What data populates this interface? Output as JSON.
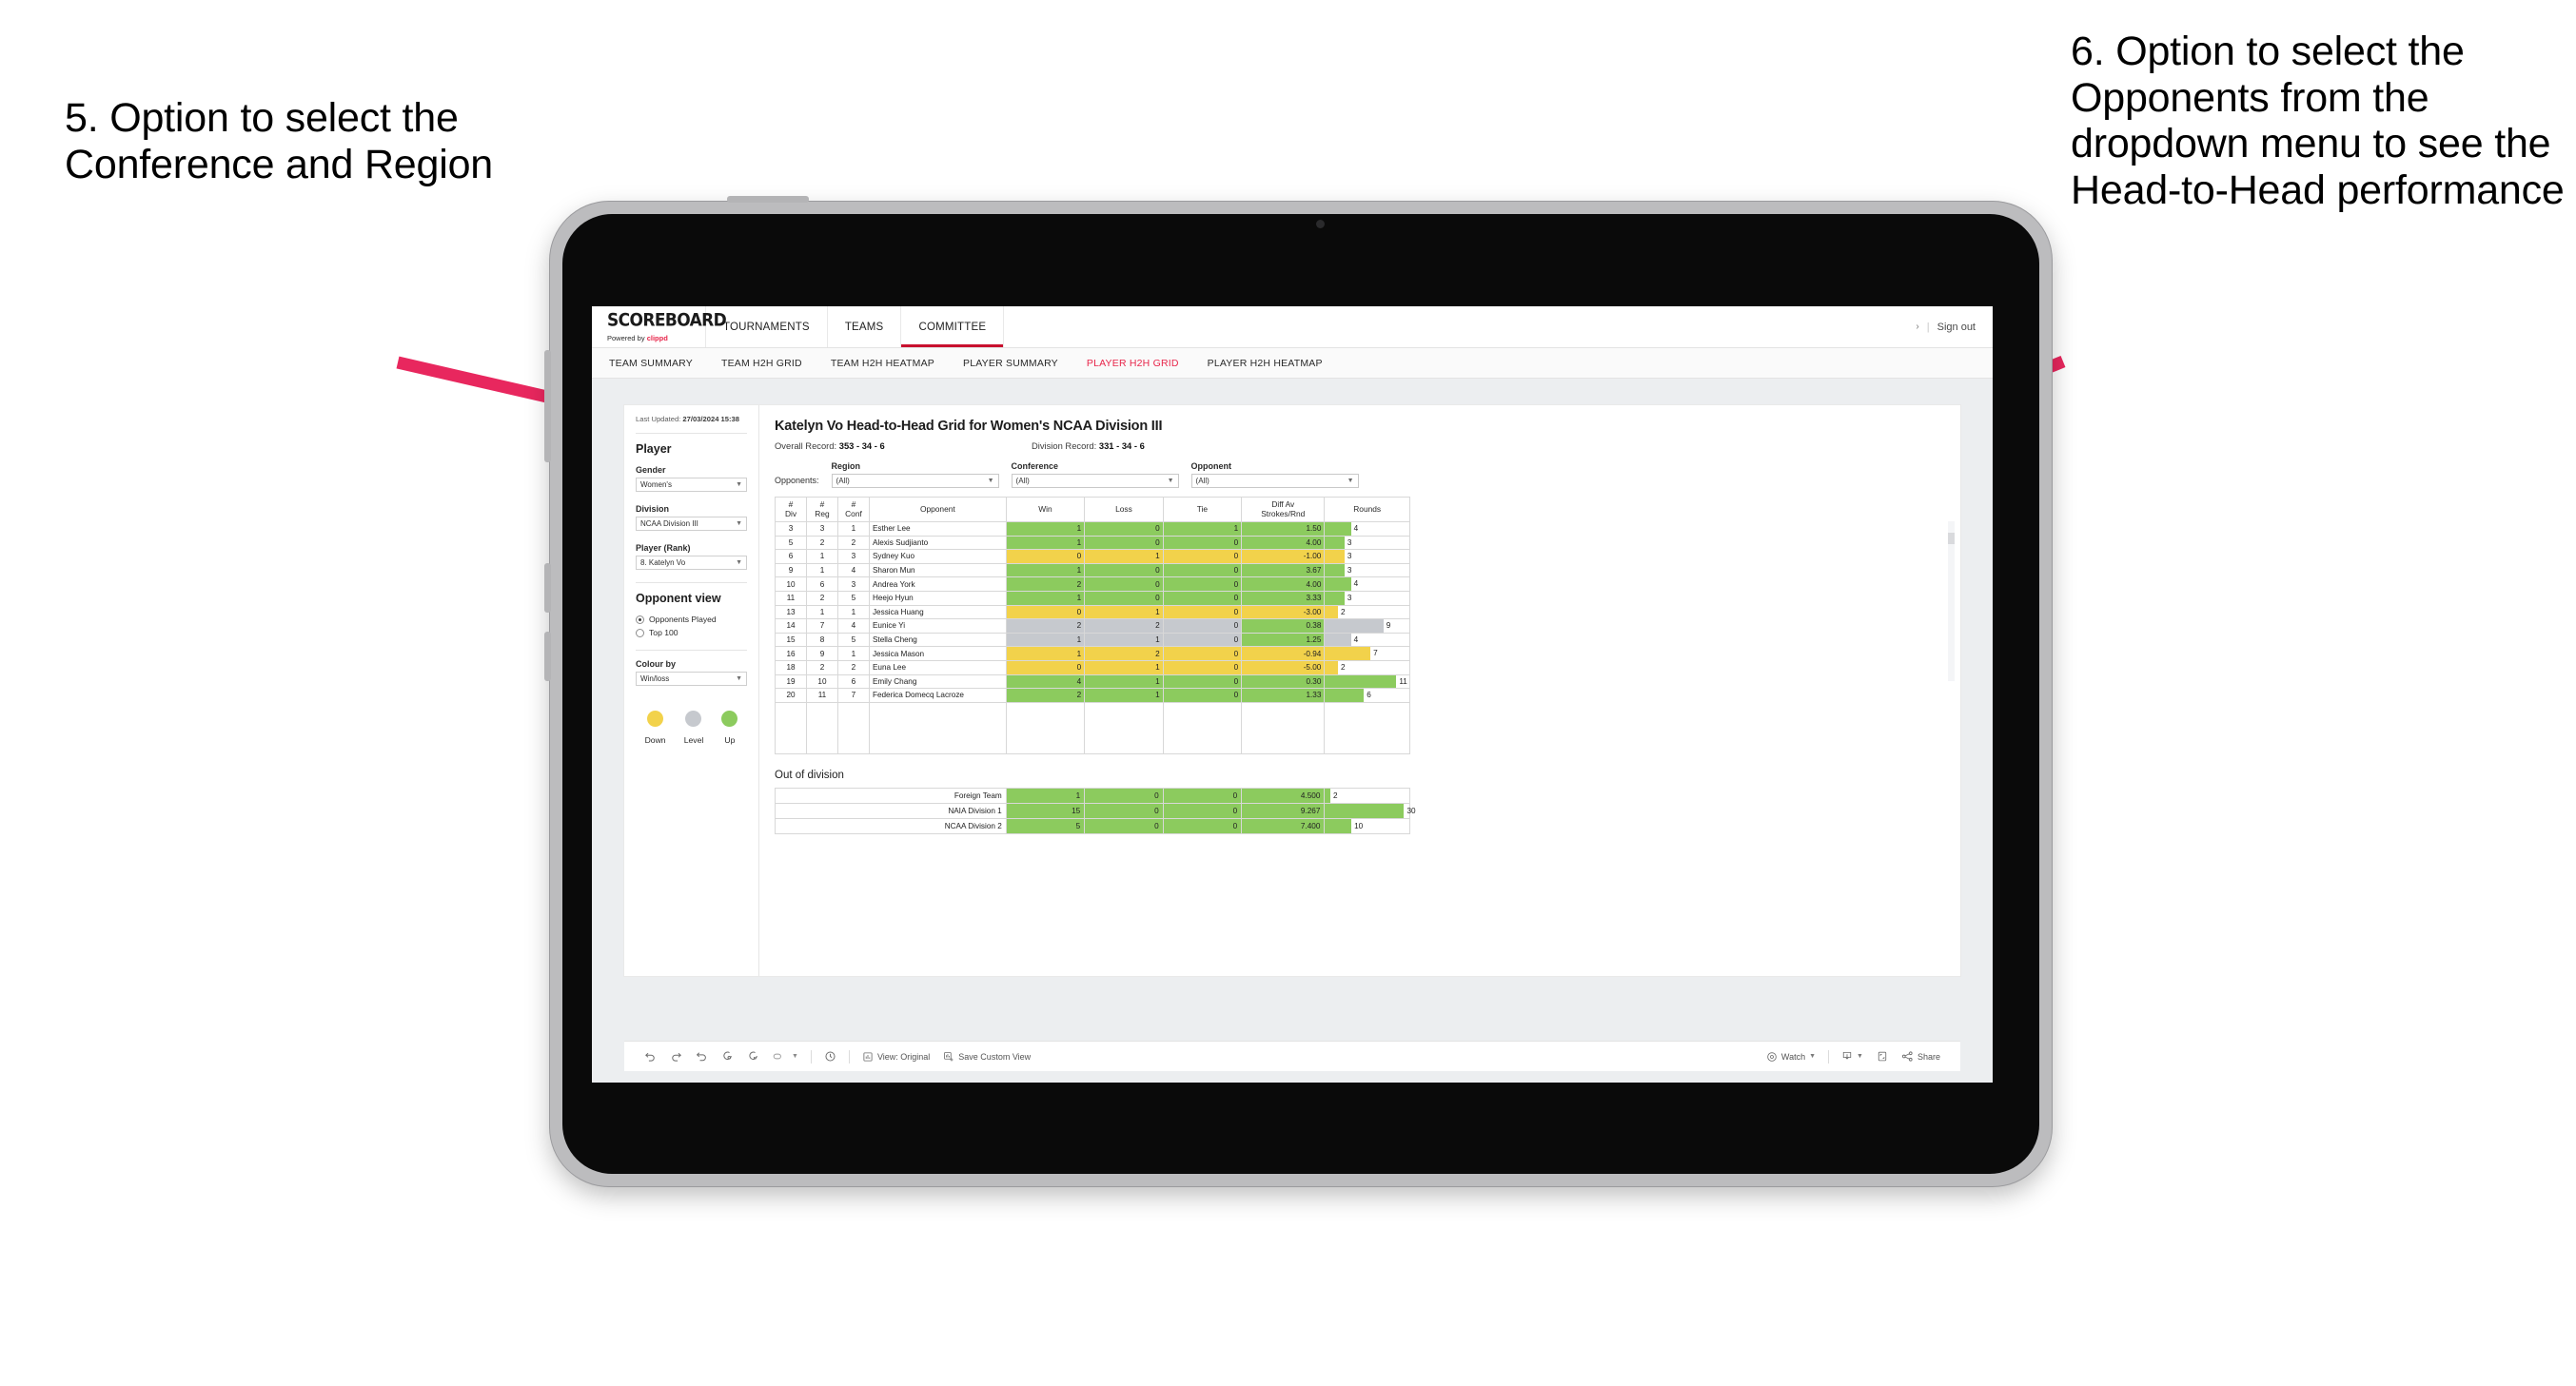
{
  "annotations": {
    "left": "5. Option to select the Conference and Region",
    "right": "6. Option to select the Opponents from the dropdown menu to see the Head-to-Head performance",
    "arrow_color": "#e8275e"
  },
  "app": {
    "logo": {
      "word": "SCOREBOARD",
      "powered_prefix": "Powered by ",
      "powered_brand": "clippd"
    },
    "topnav": [
      {
        "label": "TOURNAMENTS",
        "active": false
      },
      {
        "label": "TEAMS",
        "active": false
      },
      {
        "label": "COMMITTEE",
        "active": true
      }
    ],
    "account": {
      "chevron": "›",
      "separator": "|",
      "sign_out": "Sign out"
    },
    "subnav": [
      {
        "label": "TEAM SUMMARY",
        "active": false
      },
      {
        "label": "TEAM H2H GRID",
        "active": false
      },
      {
        "label": "TEAM H2H HEATMAP",
        "active": false
      },
      {
        "label": "PLAYER SUMMARY",
        "active": false
      },
      {
        "label": "PLAYER H2H GRID",
        "active": true
      },
      {
        "label": "PLAYER H2H HEATMAP",
        "active": false
      }
    ],
    "accent_color": "#e8264b"
  },
  "sidebar": {
    "last_updated_label": "Last Updated: ",
    "last_updated_value": "27/03/2024 15:38",
    "player_heading": "Player",
    "fields": [
      {
        "label": "Gender",
        "value": "Women's"
      },
      {
        "label": "Division",
        "value": "NCAA Division III"
      },
      {
        "label": "Player (Rank)",
        "value": "8. Katelyn Vo"
      }
    ],
    "opponent_view": {
      "heading": "Opponent view",
      "options": [
        {
          "label": "Opponents Played",
          "selected": true
        },
        {
          "label": "Top 100",
          "selected": false
        }
      ]
    },
    "colour_by": {
      "label": "Colour by",
      "value": "Win/loss"
    },
    "legend": [
      {
        "label": "Down",
        "color": "#f2d24b"
      },
      {
        "label": "Level",
        "color": "#c6c9ce"
      },
      {
        "label": "Up",
        "color": "#8ccb5e"
      }
    ]
  },
  "main": {
    "title": "Katelyn Vo Head-to-Head Grid for Women's NCAA Division III",
    "records": [
      {
        "label": "Overall Record: ",
        "value": "353 - 34 - 6"
      },
      {
        "label": "Division Record: ",
        "value": "331 - 34 - 6"
      }
    ],
    "filters_prefix": "Opponents:",
    "filters": [
      {
        "label": "Region",
        "value": "(All)"
      },
      {
        "label": "Conference",
        "value": "(All)"
      },
      {
        "label": "Opponent",
        "value": "(All)"
      }
    ],
    "grid": {
      "columns": [
        "# Div",
        "# Reg",
        "# Conf",
        "Opponent",
        "Win",
        "Loss",
        "Tie",
        "Diff Av Strokes/Rnd",
        "Rounds"
      ],
      "column_lines": [
        [
          "#",
          "Div"
        ],
        [
          "#",
          "Reg"
        ],
        [
          "#",
          "Conf"
        ],
        [
          "Opponent"
        ],
        [
          "Win"
        ],
        [
          "Loss"
        ],
        [
          "Tie"
        ],
        [
          "Diff Av",
          "Strokes/Rnd"
        ],
        [
          "Rounds"
        ]
      ],
      "rounds_max": 13,
      "rows": [
        {
          "div": "3",
          "reg": "3",
          "conf": "1",
          "opponent": "Esther Lee",
          "win": "1",
          "loss": "0",
          "tie": "1",
          "diff": "1.50",
          "rounds": "4",
          "state": "up"
        },
        {
          "div": "5",
          "reg": "2",
          "conf": "2",
          "opponent": "Alexis Sudjianto",
          "win": "1",
          "loss": "0",
          "tie": "0",
          "diff": "4.00",
          "rounds": "3",
          "state": "up"
        },
        {
          "div": "6",
          "reg": "1",
          "conf": "3",
          "opponent": "Sydney Kuo",
          "win": "0",
          "loss": "1",
          "tie": "0",
          "diff": "-1.00",
          "rounds": "3",
          "state": "down"
        },
        {
          "div": "9",
          "reg": "1",
          "conf": "4",
          "opponent": "Sharon Mun",
          "win": "1",
          "loss": "0",
          "tie": "0",
          "diff": "3.67",
          "rounds": "3",
          "state": "up"
        },
        {
          "div": "10",
          "reg": "6",
          "conf": "3",
          "opponent": "Andrea York",
          "win": "2",
          "loss": "0",
          "tie": "0",
          "diff": "4.00",
          "rounds": "4",
          "state": "up"
        },
        {
          "div": "11",
          "reg": "2",
          "conf": "5",
          "opponent": "Heejo Hyun",
          "win": "1",
          "loss": "0",
          "tie": "0",
          "diff": "3.33",
          "rounds": "3",
          "state": "up"
        },
        {
          "div": "13",
          "reg": "1",
          "conf": "1",
          "opponent": "Jessica Huang",
          "win": "0",
          "loss": "1",
          "tie": "0",
          "diff": "-3.00",
          "rounds": "2",
          "state": "down"
        },
        {
          "div": "14",
          "reg": "7",
          "conf": "4",
          "opponent": "Eunice Yi",
          "win": "2",
          "loss": "2",
          "tie": "0",
          "diff": "0.38",
          "rounds": "9",
          "state": "level",
          "diff_state": "up"
        },
        {
          "div": "15",
          "reg": "8",
          "conf": "5",
          "opponent": "Stella Cheng",
          "win": "1",
          "loss": "1",
          "tie": "0",
          "diff": "1.25",
          "rounds": "4",
          "state": "level",
          "diff_state": "up"
        },
        {
          "div": "16",
          "reg": "9",
          "conf": "1",
          "opponent": "Jessica Mason",
          "win": "1",
          "loss": "2",
          "tie": "0",
          "diff": "-0.94",
          "rounds": "7",
          "state": "down"
        },
        {
          "div": "18",
          "reg": "2",
          "conf": "2",
          "opponent": "Euna Lee",
          "win": "0",
          "loss": "1",
          "tie": "0",
          "diff": "-5.00",
          "rounds": "2",
          "state": "down"
        },
        {
          "div": "19",
          "reg": "10",
          "conf": "6",
          "opponent": "Emily Chang",
          "win": "4",
          "loss": "1",
          "tie": "0",
          "diff": "0.30",
          "rounds": "11",
          "state": "up"
        },
        {
          "div": "20",
          "reg": "11",
          "conf": "7",
          "opponent": "Federica Domecq Lacroze",
          "win": "2",
          "loss": "1",
          "tie": "0",
          "diff": "1.33",
          "rounds": "6",
          "state": "up"
        }
      ]
    },
    "out_of_division": {
      "title": "Out of division",
      "rounds_max": 32,
      "rows": [
        {
          "name": "Foreign Team",
          "win": "1",
          "loss": "0",
          "tie": "0",
          "diff": "4.500",
          "rounds": "2",
          "state": "up"
        },
        {
          "name": "NAIA Division 1",
          "win": "15",
          "loss": "0",
          "tie": "0",
          "diff": "9.267",
          "rounds": "30",
          "state": "up"
        },
        {
          "name": "NCAA Division 2",
          "win": "5",
          "loss": "0",
          "tie": "0",
          "diff": "7.400",
          "rounds": "10",
          "state": "up"
        }
      ]
    }
  },
  "toolbar": {
    "items": [
      {
        "name": "undo-icon",
        "label": ""
      },
      {
        "name": "redo-icon",
        "label": ""
      },
      {
        "name": "revert-icon",
        "label": ""
      },
      {
        "name": "refresh-icon",
        "label": ""
      },
      {
        "name": "pause-icon",
        "label": ""
      },
      {
        "name": "highlight-icon",
        "label": ""
      },
      {
        "name": "clock-icon",
        "label": ""
      },
      {
        "name": "view-original",
        "label": "View: Original"
      },
      {
        "name": "save-custom-view",
        "label": "Save Custom View"
      },
      {
        "name": "watch",
        "label": "Watch"
      },
      {
        "name": "download-icon",
        "label": ""
      },
      {
        "name": "fullscreen-icon",
        "label": ""
      },
      {
        "name": "share",
        "label": "Share"
      }
    ]
  },
  "colors": {
    "up": "#8ccb5e",
    "down": "#f2d24b",
    "level": "#c6c9ce",
    "accent": "#e8264b",
    "arrow": "#e8275e"
  }
}
